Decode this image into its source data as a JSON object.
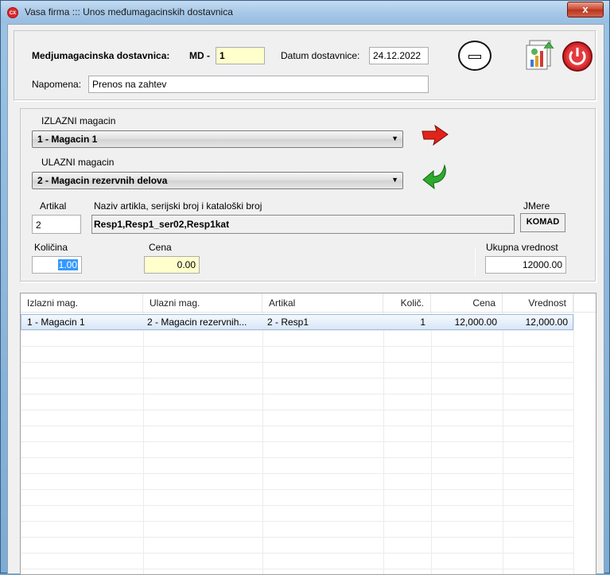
{
  "window": {
    "title": "Vasa firma ::: Unos međumagacinskih dostavnica",
    "app_icon_text": "CX",
    "close_label": "x"
  },
  "header": {
    "doc_label": "Medjumagacinska dostavnica:",
    "md_label": "MD -",
    "md_value": "1",
    "date_label": "Datum dostavnice:",
    "date_value": "24.12.2022",
    "note_label": "Napomena:",
    "note_value": "Prenos na zahtev"
  },
  "transfer": {
    "out_label": "IZLAZNI magacin",
    "out_value": "1 - Magacin 1",
    "in_label": "ULAZNI magacin",
    "in_value": "2 - Magacin rezervnih delova"
  },
  "item": {
    "artikal_label": "Artikal",
    "artikal_value": "2",
    "naziv_label": "Naziv artikla, serijski broj i kataloški broj",
    "naziv_value": "Resp1,Resp1_ser02,Resp1kat",
    "jmere_label": "JMere",
    "jmere_value": "KOMAD",
    "kolicina_label": "Količina",
    "kolicina_value": "1.00",
    "cena_label": "Cena",
    "cena_value": "0.00",
    "ukupno_label": "Ukupna vrednost",
    "ukupno_value": "12000.00"
  },
  "grid": {
    "columns": [
      "Izlazni mag.",
      "Ulazni mag.",
      "Artikal",
      "Količ.",
      "Cena",
      "Vrednost"
    ],
    "rows": [
      [
        "1 - Magacin 1",
        "2 - Magacin rezervnih...",
        "2 - Resp1",
        "1",
        "12,000.00",
        "12,000.00"
      ]
    ]
  },
  "icons": {
    "minimize": "minus-circle-icon",
    "report": "report-chart-icon",
    "power": "power-icon",
    "out_arrow": "red-arrow-right-icon",
    "in_arrow": "green-arrow-curved-icon"
  }
}
